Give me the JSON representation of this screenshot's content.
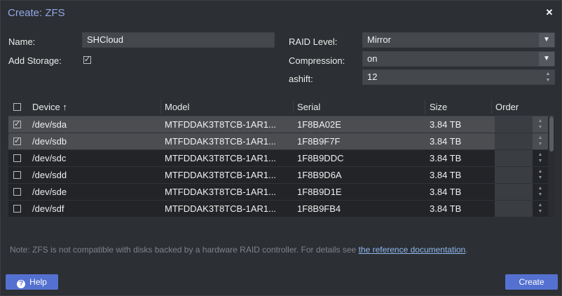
{
  "dialog": {
    "title": "Create: ZFS"
  },
  "form": {
    "name_label": "Name:",
    "name_value": "SHCloud",
    "add_storage_label": "Add Storage:",
    "add_storage_checked": true,
    "raid_label": "RAID Level:",
    "raid_value": "Mirror",
    "compression_label": "Compression:",
    "compression_value": "on",
    "ashift_label": "ashift:",
    "ashift_value": "12"
  },
  "grid": {
    "columns": {
      "device": "Device ↑",
      "model": "Model",
      "serial": "Serial",
      "size": "Size",
      "order": "Order"
    },
    "rows": [
      {
        "device": "/dev/sda",
        "model": "MTFDDAK3T8TCB-1AR1...",
        "serial": "1F8BA02E",
        "size": "3.84 TB",
        "checked": true
      },
      {
        "device": "/dev/sdb",
        "model": "MTFDDAK3T8TCB-1AR1...",
        "serial": "1F8B9F7F",
        "size": "3.84 TB",
        "checked": true
      },
      {
        "device": "/dev/sdc",
        "model": "MTFDDAK3T8TCB-1AR1...",
        "serial": "1F8B9DDC",
        "size": "3.84 TB",
        "checked": false
      },
      {
        "device": "/dev/sdd",
        "model": "MTFDDAK3T8TCB-1AR1...",
        "serial": "1F8B9D6A",
        "size": "3.84 TB",
        "checked": false
      },
      {
        "device": "/dev/sde",
        "model": "MTFDDAK3T8TCB-1AR1...",
        "serial": "1F8B9D1E",
        "size": "3.84 TB",
        "checked": false
      },
      {
        "device": "/dev/sdf",
        "model": "MTFDDAK3T8TCB-1AR1...",
        "serial": "1F8B9FB4",
        "size": "3.84 TB",
        "checked": false
      }
    ]
  },
  "note": {
    "text": "Note: ZFS is not compatible with disks backed by a hardware RAID controller. For details see ",
    "link": "the reference documentation",
    "suffix": "."
  },
  "buttons": {
    "help": "Help",
    "create": "Create"
  }
}
